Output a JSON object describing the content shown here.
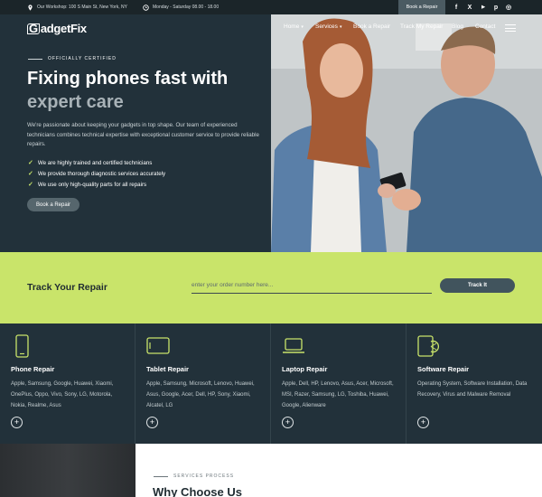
{
  "topbar": {
    "address": "Our Workshop: 100 S Main St, New York, NY",
    "hours": "Monday - Saturday 08.00 - 18.00",
    "book_label": "Book a Repair",
    "socials": [
      "f",
      "X",
      "▶",
      "p",
      "◎"
    ]
  },
  "brand": {
    "logo": "adgetFix",
    "logo_letter": "G"
  },
  "nav": [
    {
      "label": "Home",
      "has_dropdown": true
    },
    {
      "label": "Services",
      "has_dropdown": true
    },
    {
      "label": "Book a Repair",
      "has_dropdown": false
    },
    {
      "label": "Track My Repair",
      "has_dropdown": false
    },
    {
      "label": "Blog",
      "has_dropdown": false
    },
    {
      "label": "Contact",
      "has_dropdown": false
    }
  ],
  "hero": {
    "kicker": "OFFICIALLY CERTIFIED",
    "title_line1": "Fixing phones fast with",
    "title_line2": "expert care",
    "description": "We're passionate about keeping your gadgets in top shape. Our team of experienced technicians combines technical expertise with exceptional customer service to provide reliable repairs.",
    "bullets": [
      "We are highly trained and certified technicians",
      "We provide thorough diagnostic services accurately",
      "We use only high-quality parts for all repairs"
    ],
    "cta": "Book a Repair"
  },
  "track": {
    "title": "Track Your Repair",
    "placeholder": "enter your order number here...",
    "button": "Track It"
  },
  "services": [
    {
      "icon": "phone-icon",
      "title": "Phone Repair",
      "body": "Apple, Samsung, Google, Huawei, Xiaomi, OnePlus, Oppo, Vivo, Sony, LG, Motorola, Nokia, Realme, Asus"
    },
    {
      "icon": "tablet-icon",
      "title": "Tablet Repair",
      "body": "Apple, Samsung, Microsoft, Lenovo, Huawei, Asus, Google, Acer, Dell, HP, Sony, Xiaomi, Alcatel, LG"
    },
    {
      "icon": "laptop-icon",
      "title": "Laptop Repair",
      "body": "Apple, Dell, HP, Lenovo, Asus, Acer, Microsoft, MSI, Razer, Samsung, LG, Toshiba, Huawei, Google, Alienware"
    },
    {
      "icon": "software-icon",
      "title": "Software Repair",
      "body": "Operating System, Software Installation, Data Recovery, Virus and Malware Removal"
    }
  ],
  "process": {
    "kicker": "SERVICES PROCESS",
    "title": "Why Choose Us"
  },
  "colors": {
    "accent": "#c9e46a",
    "dark": "#22313a",
    "button": "#41545d"
  }
}
